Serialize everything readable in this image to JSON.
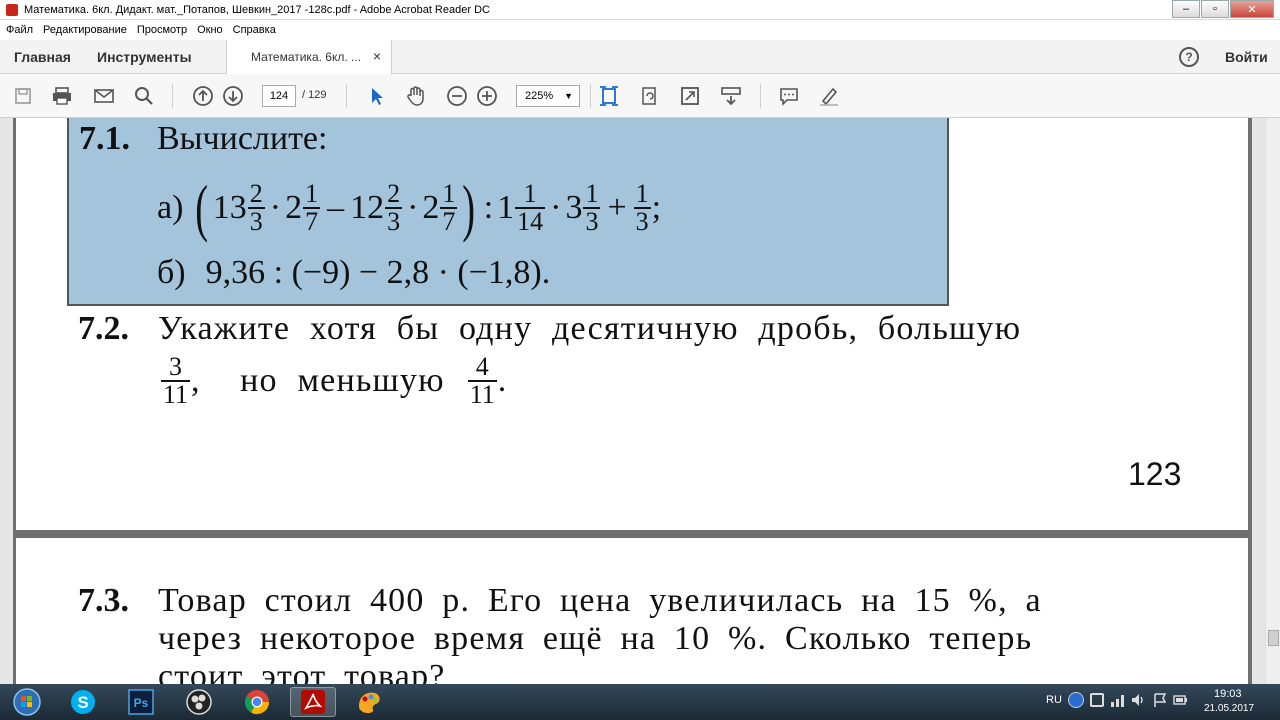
{
  "window": {
    "title": "Математика. 6кл. Дидакт. мат._Потапов, Шевкин_2017 -128c.pdf - Adobe Acrobat Reader DC",
    "min": "–",
    "max": "▫",
    "close": "✕"
  },
  "menu": [
    "Файл",
    "Редактирование",
    "Просмотр",
    "Окно",
    "Справка"
  ],
  "tabs": {
    "home": "Главная",
    "tools": "Инструменты",
    "doc": "Математика. 6кл. ...",
    "doc_close": "×",
    "help": "?",
    "login": "Войти"
  },
  "toolbar": {
    "page_current": "124",
    "page_total": "/ 129",
    "zoom": "225%"
  },
  "page1": {
    "t71_num": "7.1.",
    "t71_title": "Вычислите:",
    "a_label": "а)",
    "a_w1": "13",
    "a_f1n": "2",
    "a_f1d": "3",
    "dot": "·",
    "a_w2": "2",
    "a_f2n": "1",
    "a_f2d": "7",
    "minus": "–",
    "a_w3": "12",
    "a_f3n": "2",
    "a_f3d": "3",
    "a_w4": "2",
    "a_f4n": "1",
    "a_f4d": "7",
    "colon": ":",
    "a_w5": "1",
    "a_f5n": "1",
    "a_f5d": "14",
    "a_w6": "3",
    "a_f6n": "1",
    "a_f6d": "3",
    "plus": "+",
    "a_f7n": "1",
    "a_f7d": "3",
    "semi": ";",
    "lparen": "(",
    "rparen": ")",
    "b_label": "б)",
    "b_expr": "9,36 : (−9) − 2,8 · (−1,8).",
    "t72_num": "7.2.",
    "t72_line1": "Укажите хотя бы одну десятичную дробь, большую",
    "t72_f1n": "3",
    "t72_f1d": "11",
    "t72_mid": ",  но меньшую",
    "t72_f2n": "4",
    "t72_f2d": "11",
    "t72_end": ".",
    "page_number": "123"
  },
  "page2": {
    "t73_num": "7.3.",
    "t73_line1": "Товар стоил 400 р. Его цена увеличилась на 15 %, а",
    "t73_line2": "через некоторое время ещё на 10 %. Сколько теперь",
    "t73_line3": "стоит этот товар?"
  },
  "taskbar": {
    "lang": "RU",
    "time": "19:03",
    "date": "21.05.2017",
    "apps": [
      "start-orb",
      "skype",
      "photoshop",
      "obs",
      "chrome",
      "acrobat",
      "paint"
    ]
  }
}
